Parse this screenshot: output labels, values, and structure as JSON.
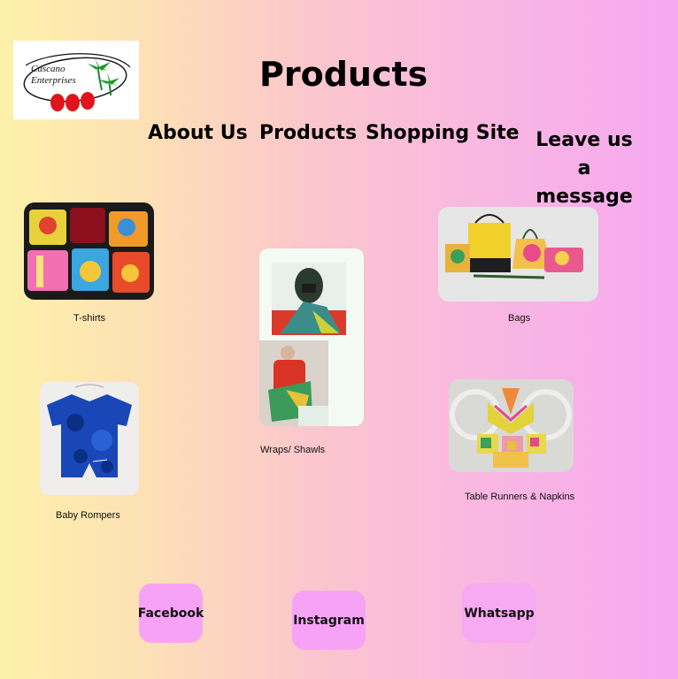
{
  "logo": {
    "line1": "Cuscano",
    "line2": "Enterprises",
    "icon": "palm-tree-logo-icon"
  },
  "page": {
    "title": "Products"
  },
  "nav": {
    "about": "About Us",
    "products": "Products",
    "shopping": "Shopping Site",
    "message_line1": "Leave  us",
    "message_line2": "a message"
  },
  "products": {
    "tshirts": "T-shirts",
    "wraps": "Wraps/ Shawls",
    "bags": "Bags",
    "rompers": "Baby Rompers",
    "runners": "Table Runners & Napkins"
  },
  "social": {
    "facebook": "Facebook",
    "instagram": "Instagram",
    "whatsapp": "Whatsapp"
  },
  "colors": {
    "social_button": "#f7a3f5",
    "gradient_left": "#fdf1a9",
    "gradient_right": "#f6a8f1"
  }
}
